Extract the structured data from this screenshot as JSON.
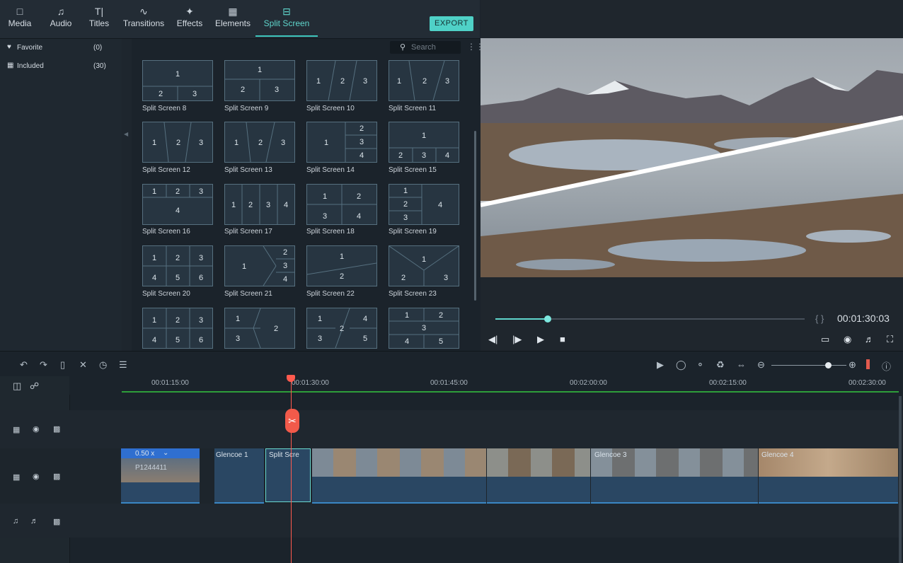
{
  "toolbar": {
    "tabs": [
      {
        "label": "Media",
        "icon": "folder-icon"
      },
      {
        "label": "Audio",
        "icon": "music-note-icon"
      },
      {
        "label": "Titles",
        "icon": "text-icon"
      },
      {
        "label": "Transitions",
        "icon": "transition-icon"
      },
      {
        "label": "Effects",
        "icon": "effects-icon"
      },
      {
        "label": "Elements",
        "icon": "image-icon"
      },
      {
        "label": "Split Screen",
        "icon": "split-screen-icon"
      }
    ],
    "active_tab": "Split Screen",
    "export_label": "EXPORT"
  },
  "categories": [
    {
      "label": "Favorite",
      "count": "(0)",
      "icon": "heart-icon"
    },
    {
      "label": "Included",
      "count": "(30)",
      "icon": "grid-icon"
    }
  ],
  "search": {
    "placeholder": "Search"
  },
  "split_screens": [
    {
      "label": "Split Screen 8",
      "nums": [
        "1",
        "2",
        "3"
      ]
    },
    {
      "label": "Split Screen 9",
      "nums": [
        "1",
        "2",
        "3"
      ]
    },
    {
      "label": "Split Screen 10",
      "nums": [
        "1",
        "2",
        "3"
      ]
    },
    {
      "label": "Split Screen 11",
      "nums": [
        "1",
        "2",
        "3"
      ]
    },
    {
      "label": "Split Screen 12",
      "nums": [
        "1",
        "2",
        "3"
      ]
    },
    {
      "label": "Split Screen 13",
      "nums": [
        "1",
        "2",
        "3"
      ]
    },
    {
      "label": "Split Screen 14",
      "nums": [
        "1",
        "2",
        "3",
        "4"
      ]
    },
    {
      "label": "Split Screen 15",
      "nums": [
        "1",
        "2",
        "3",
        "4"
      ]
    },
    {
      "label": "Split Screen 16",
      "nums": [
        "1",
        "2",
        "3",
        "4"
      ]
    },
    {
      "label": "Split Screen 17",
      "nums": [
        "1",
        "2",
        "3",
        "4"
      ]
    },
    {
      "label": "Split Screen 18",
      "nums": [
        "1",
        "2",
        "3",
        "4"
      ]
    },
    {
      "label": "Split Screen 19",
      "nums": [
        "1",
        "2",
        "3",
        "4"
      ]
    },
    {
      "label": "Split Screen 20",
      "nums": [
        "1",
        "2",
        "3",
        "4",
        "5",
        "6"
      ]
    },
    {
      "label": "Split Screen 21",
      "nums": [
        "1",
        "2",
        "3",
        "4"
      ]
    },
    {
      "label": "Split Screen 22",
      "nums": [
        "1",
        "2"
      ]
    },
    {
      "label": "Split Screen 23",
      "nums": [
        "1",
        "2",
        "3"
      ]
    },
    {
      "label": "",
      "nums": [
        "1",
        "2",
        "3",
        "4",
        "5",
        "6"
      ]
    },
    {
      "label": "",
      "nums": [
        "1",
        "2",
        "3"
      ]
    },
    {
      "label": "",
      "nums": [
        "1",
        "2",
        "3",
        "4",
        "5"
      ]
    },
    {
      "label": "",
      "nums": [
        "1",
        "2",
        "3",
        "4",
        "5"
      ]
    }
  ],
  "preview": {
    "timecode": "00:01:30:03",
    "progress": 0.17
  },
  "timeline": {
    "ruler": [
      "00:01:15:00",
      "00:01:30:00",
      "00:01:45:00",
      "00:02:00:00",
      "00:02:15:00",
      "00:02:30:00"
    ],
    "zoom": 0.75,
    "clips": [
      {
        "label": "0.50 x",
        "sub": "P1244411"
      },
      {
        "label": "Glencoe 1"
      },
      {
        "label": "Split Scre"
      },
      {
        "label": "Glencoe 3"
      },
      {
        "label": "Glencoe 4"
      }
    ]
  }
}
